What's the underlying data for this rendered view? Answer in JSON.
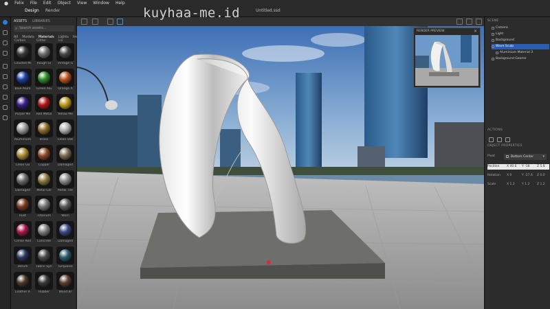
{
  "menubar": {
    "apple_icon": "apple-icon",
    "items": [
      "Felix",
      "File",
      "Edit",
      "Object",
      "View",
      "Window",
      "Help"
    ]
  },
  "toolbar": {
    "tabs": [
      "Design",
      "Render"
    ],
    "document_title": "Untitled.ssd"
  },
  "watermark": "kuyhaa-me.id",
  "assets": {
    "tabs": [
      "ASSETS",
      "LIBRARIES"
    ],
    "search_placeholder": "Search assets...",
    "filters": [
      "All",
      "Models",
      "Materials",
      "Lights",
      "Images"
    ],
    "selected_filter": "Materials",
    "partial_row_labels": [
      "Carbon",
      "Glitter",
      "Ice"
    ],
    "materials": [
      {
        "label": "Clouded Mi",
        "color": "#3a3a3a"
      },
      {
        "label": "Rough Gl",
        "color": "#6d6d6d"
      },
      {
        "label": "Vintage G",
        "color": "#4a4540"
      },
      {
        "label": "Blue Alum",
        "color": "#1d3fa0"
      },
      {
        "label": "Green Alu",
        "color": "#2e8a2a"
      },
      {
        "label": "Orange A",
        "color": "#b5521c"
      },
      {
        "label": "Purple Me",
        "color": "#3b1f8a"
      },
      {
        "label": "Red Metal",
        "color": "#b01818"
      },
      {
        "label": "Yellow Me",
        "color": "#b99a18"
      },
      {
        "label": "Aluminium",
        "color": "#9a9a9a"
      },
      {
        "label": "Brass",
        "color": "#8c6d2a"
      },
      {
        "label": "Clean Stel",
        "color": "#b0b0b0"
      },
      {
        "label": "Clean Go",
        "color": "#a88a35"
      },
      {
        "label": "Copper",
        "color": "#8a4a28"
      },
      {
        "label": "Damaged",
        "color": "#7a6a50"
      },
      {
        "label": "Damaged",
        "color": "#6a6a6a"
      },
      {
        "label": "Metal Gol",
        "color": "#8a7a40"
      },
      {
        "label": "Metal Tile",
        "color": "#8a8a8a"
      },
      {
        "label": "Rust",
        "color": "#7a3a22"
      },
      {
        "label": "Titanium",
        "color": "#777777"
      },
      {
        "label": "Worn",
        "color": "#5a5a5a"
      },
      {
        "label": "Cerise Red",
        "color": "#a81850"
      },
      {
        "label": "Concrete",
        "color": "#7d7d7d"
      },
      {
        "label": "Damaged",
        "color": "#3a4a80"
      },
      {
        "label": "Denim",
        "color": "#2a3a5a"
      },
      {
        "label": "Fabric Syn",
        "color": "#4a4a4a"
      },
      {
        "label": "Turquoise",
        "color": "#2a5a6a"
      },
      {
        "label": "Leather A",
        "color": "#4a3a2a"
      },
      {
        "label": "Rubber",
        "color": "#3a3a3a"
      },
      {
        "label": "Wood Br",
        "color": "#5a4030"
      }
    ]
  },
  "preview": {
    "title": "RENDER PREVIEW",
    "close_label": "×"
  },
  "scene": {
    "header": "SCENE",
    "items": [
      {
        "label": "Camera",
        "selected": false,
        "indent": 0
      },
      {
        "label": "Light",
        "selected": false,
        "indent": 0
      },
      {
        "label": "Background",
        "selected": false,
        "indent": 0
      },
      {
        "label": "Wave Sculp",
        "selected": true,
        "indent": 0
      },
      {
        "label": "Aluminium Material 3",
        "selected": false,
        "indent": 1
      },
      {
        "label": "Background Geome",
        "selected": false,
        "indent": 0
      }
    ]
  },
  "actions": {
    "header": "ACTIONS"
  },
  "object_properties": {
    "header": "OBJECT PROPERTIES",
    "pivot_label": "Pivot",
    "pivot_value": "Bottom Center",
    "rows": [
      {
        "label": "Position",
        "x": "X  40.6",
        "y": "Y  -18",
        "z": "Z  5.8"
      },
      {
        "label": "Rotation",
        "x": "X  0",
        "y": "Y  -27.6",
        "z": "Z  0.0"
      },
      {
        "label": "Scale",
        "x": "X  1.2",
        "y": "Y  1.2",
        "z": "Z  1.2"
      }
    ]
  }
}
